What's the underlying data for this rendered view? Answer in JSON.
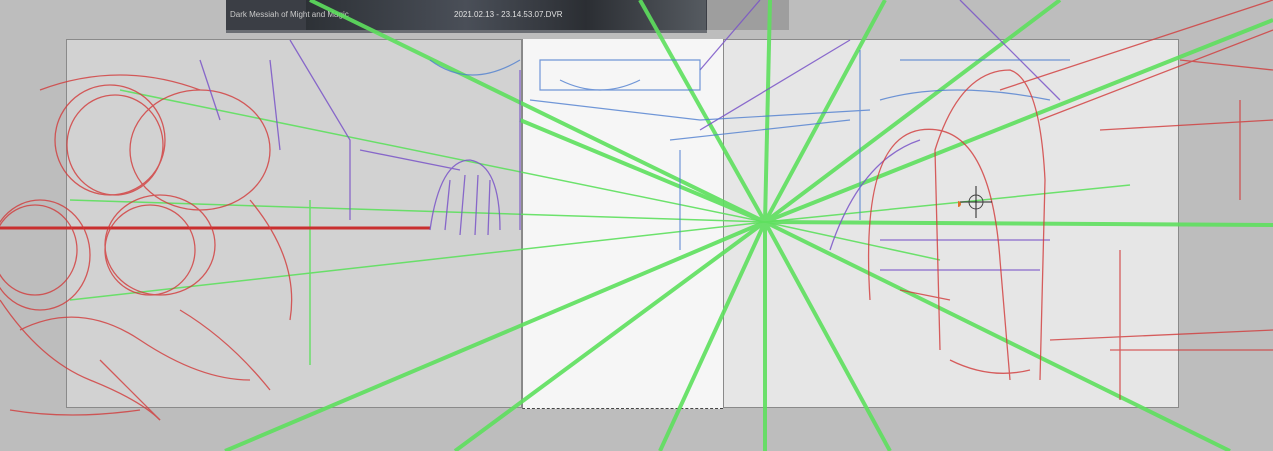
{
  "reference_window": {
    "title": "Dark Messiah of Might and Magic",
    "filename": "2021.02.13 - 23.14.53.07.DVR"
  },
  "colors": {
    "perspective_guides": "#5ee05e",
    "red_sketch": "#d23a3a",
    "purple_sketch": "#7a55c8",
    "blue_sketch": "#4f7fd0"
  },
  "icons": {
    "cursor": "crosshair-cursor-icon"
  }
}
